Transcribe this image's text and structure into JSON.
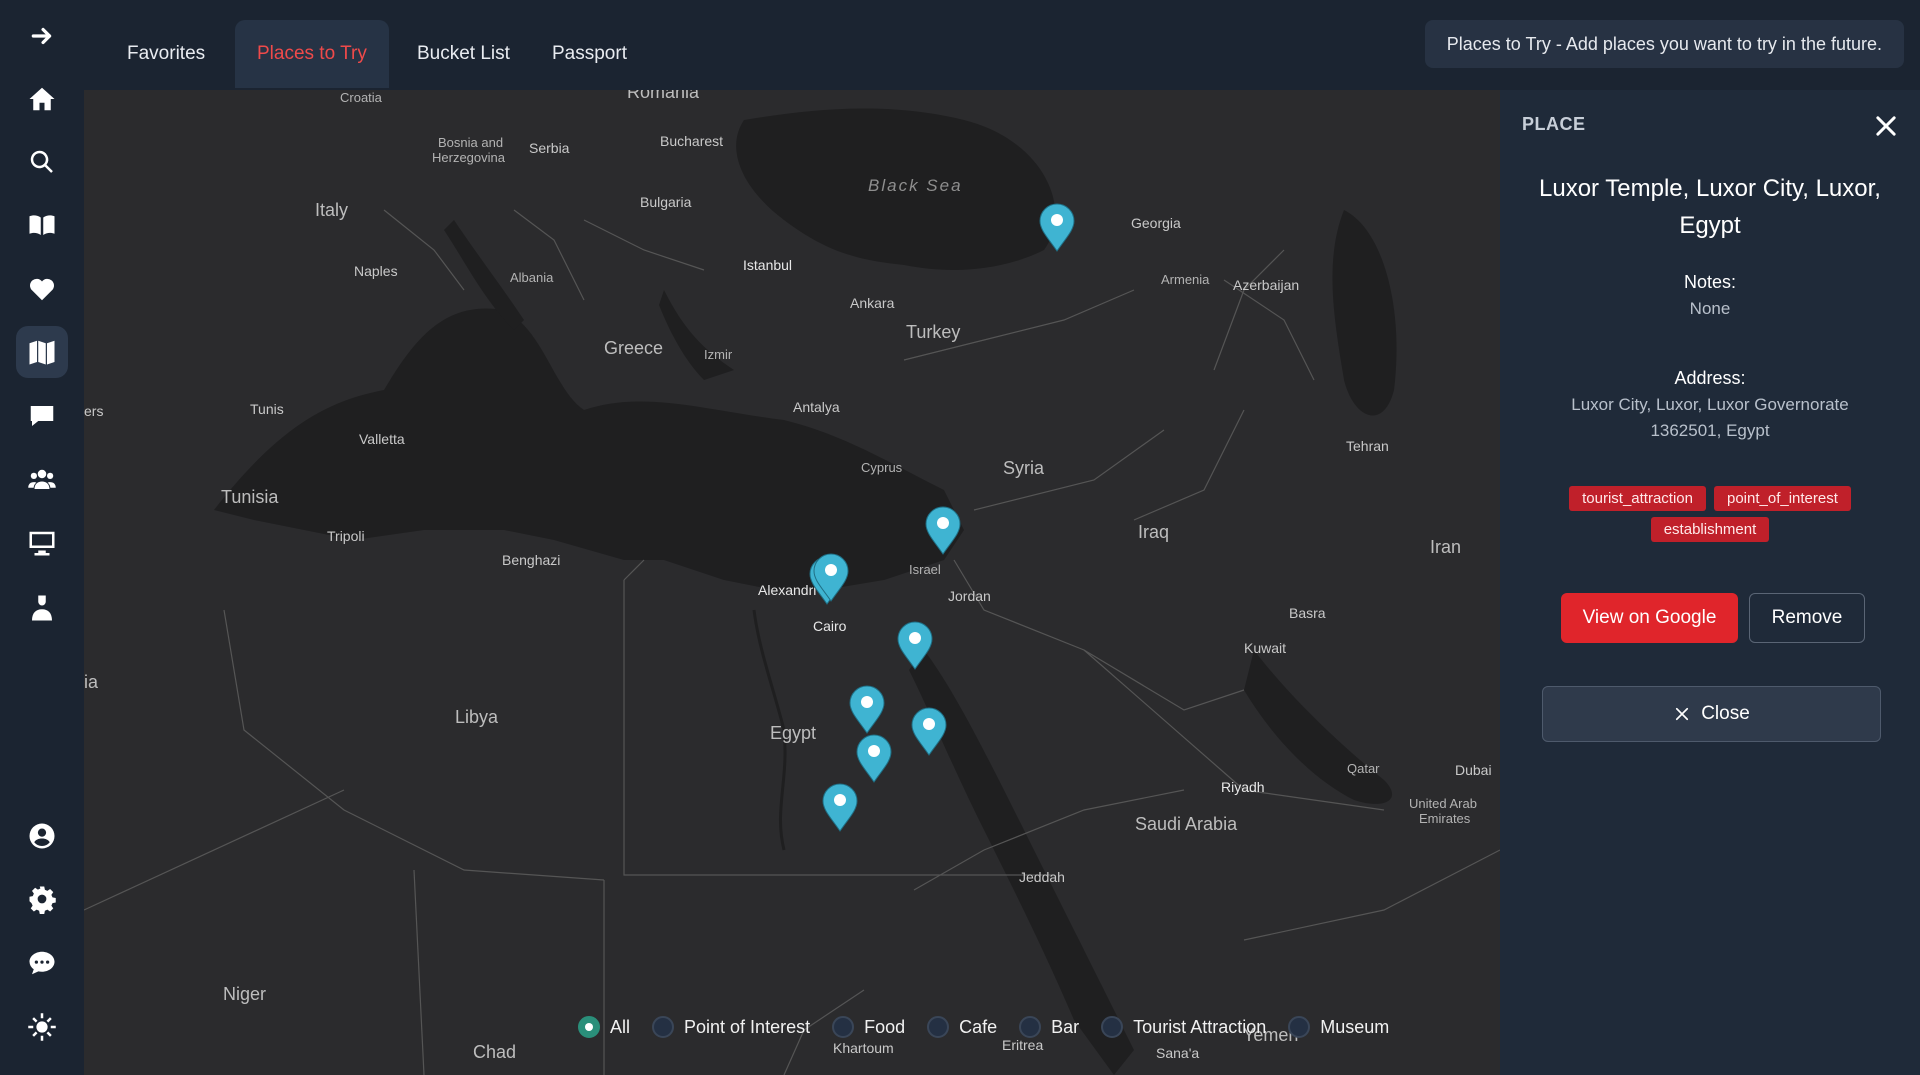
{
  "tabs": [
    {
      "label": "Favorites"
    },
    {
      "label": "Places to Try"
    },
    {
      "label": "Bucket List"
    },
    {
      "label": "Passport"
    }
  ],
  "active_tab": "Places to Try",
  "info_banner": "Places to Try - Add places you want to try in the future.",
  "sidebar": {
    "icons": [
      "arrow-right-icon",
      "home-icon",
      "search-icon",
      "book-icon",
      "heart-icon",
      "map-icon",
      "chat-bubble-icon",
      "users-icon",
      "monitor-icon",
      "user-bust-icon",
      "account-circle-icon",
      "gear-icon",
      "comment-icon",
      "sun-icon"
    ],
    "active": "map-icon"
  },
  "map": {
    "labels": {
      "croatia": "Croatia",
      "romania": "Romania",
      "bosnia": "Bosnia and",
      "herzegovina": "Herzegovina",
      "serbia": "Serbia",
      "bucharest": "Bucharest",
      "italy": "Italy",
      "bulgaria": "Bulgaria",
      "black_sea": "Black Sea",
      "georgia": "Georgia",
      "naples": "Naples",
      "albania": "Albania",
      "istanbul": "Istanbul",
      "armenia": "Armenia",
      "azerbaijan": "Azerbaijan",
      "ankara": "Ankara",
      "turkey": "Turkey",
      "greece": "Greece",
      "izmir": "Izmir",
      "ers": "ers",
      "tunis": "Tunis",
      "antalya": "Antalya",
      "valletta": "Valletta",
      "tehran": "Tehran",
      "cyprus": "Cyprus",
      "syria": "Syria",
      "tunisia": "Tunisia",
      "iraq": "Iraq",
      "tripoli": "Tripoli",
      "iran": "Iran",
      "israel": "Israel",
      "benghazi": "Benghazi",
      "alexandria": "Alexandri",
      "jordan": "Jordan",
      "basra": "Basra",
      "cairo": "Cairo",
      "kuwait": "Kuwait",
      "ia": "ia",
      "libya": "Libya",
      "egypt": "Egypt",
      "qatar": "Qatar",
      "dubai": "Dubai",
      "riyadh": "Riyadh",
      "uae1": "United Arab",
      "uae2": "Emirates",
      "saudi_arabia": "Saudi Arabia",
      "jeddah": "Jeddah",
      "niger": "Niger",
      "chad": "Chad",
      "khartoum": "Khartoum",
      "eritrea": "Eritrea",
      "yemen": "Yemen",
      "sanaa": "Sana'a"
    },
    "pins": 9
  },
  "filters": [
    {
      "label": "All",
      "selected": true
    },
    {
      "label": "Point of Interest",
      "selected": false
    },
    {
      "label": "Food",
      "selected": false
    },
    {
      "label": "Cafe",
      "selected": false
    },
    {
      "label": "Bar",
      "selected": false
    },
    {
      "label": "Tourist Attraction",
      "selected": false
    },
    {
      "label": "Museum",
      "selected": false
    }
  ],
  "place_panel": {
    "header": "PLACE",
    "title": "Luxor Temple, Luxor City, Luxor, Egypt",
    "notes_label": "Notes:",
    "notes_value": "None",
    "address_label": "Address:",
    "address_line1": "Luxor City, Luxor, Luxor Governorate",
    "address_line2": "1362501, Egypt",
    "tags": [
      "tourist_attraction",
      "point_of_interest",
      "establishment"
    ],
    "view_google_label": "View on Google",
    "remove_label": "Remove",
    "close_label": "Close"
  },
  "colors": {
    "accent_red": "#e0252b",
    "pin": "#3fb4d2",
    "tab_active_text": "#ef4a4a",
    "map_bg": "#2b2b2d",
    "sea": "#1f1f20"
  }
}
